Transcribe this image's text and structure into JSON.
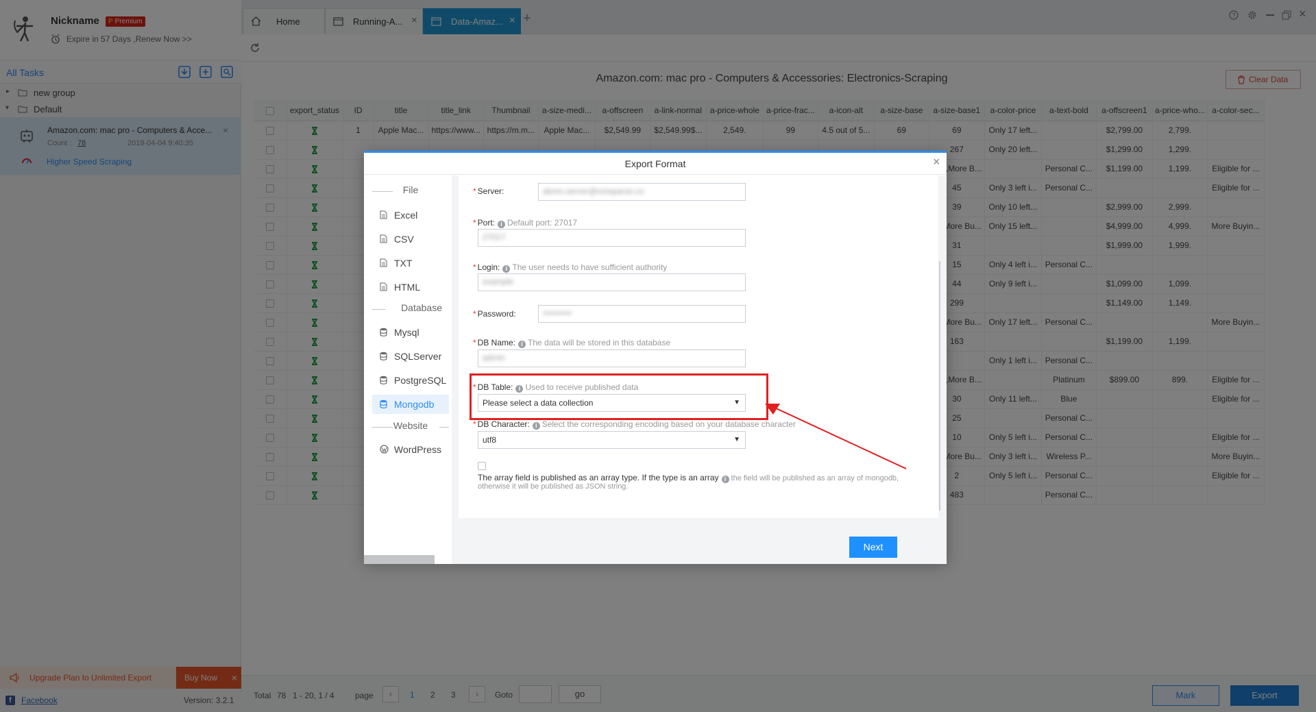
{
  "profile": {
    "nickname": "Nickname",
    "badge_p": "P",
    "badge_text": "Premium",
    "expire": "Expire in 57 Days ,Renew Now >>"
  },
  "sidebar": {
    "all_tasks": "All Tasks",
    "groups": [
      {
        "label": "new group"
      },
      {
        "label": "Default"
      }
    ],
    "task": {
      "title": "Amazon.com: mac pro - Computers & Acce...",
      "count_label": "Count :",
      "count": "78",
      "date": "2019-04-04 9:40:35",
      "speed": "Higher Speed Scraping"
    },
    "upgrade": "Upgrade Plan to Unlimited Export",
    "buy_now": "Buy Now",
    "facebook": "Facebook",
    "version": "Version: 3.2.1"
  },
  "tabs": [
    {
      "label": "Home"
    },
    {
      "label": "Running-A..."
    },
    {
      "label": "Data-Amaz..."
    }
  ],
  "main": {
    "title": "Amazon.com: mac pro - Computers & Accessories: Electronics-Scraping",
    "clear_data": "Clear Data"
  },
  "table": {
    "headers": [
      "export_status",
      "ID",
      "title",
      "title_link",
      "Thumbnail",
      "a-size-medi...",
      "a-offscreen",
      "a-link-normal",
      "a-price-whole",
      "a-price-frac...",
      "a-icon-alt",
      "a-size-base",
      "a-size-base1",
      "a-color-price",
      "a-text-bold",
      "a-offscreen1",
      "a-price-who...",
      "a-color-sec..."
    ],
    "rows": [
      [
        "1",
        "Apple Mac...",
        "https://www...",
        "https://m.m...",
        "Apple Mac...",
        "$2,549.99",
        "$2,549.99$...",
        "2,549.",
        "99",
        "4.5 out of 5...",
        "69",
        "69",
        "Only 17 left...",
        "",
        "$2,799.00",
        "2,799.",
        ""
      ],
      [
        "",
        "",
        "",
        "",
        "",
        "",
        "",
        "",
        "",
        "",
        "",
        "267",
        "Only 20 left...",
        "",
        "$1,299.00",
        "1,299.",
        ""
      ],
      [
        "",
        "",
        "",
        "",
        "",
        "",
        "",
        "",
        "",
        "",
        "",
        "321,More B...",
        "",
        "Personal C...",
        "$1,199.00",
        "1,199.",
        "Eligible for ..."
      ],
      [
        "",
        "",
        "",
        "",
        "",
        "",
        "",
        "",
        "",
        "",
        "",
        "45",
        "Only 3 left i...",
        "Personal C...",
        "",
        "",
        "Eligible for ..."
      ],
      [
        "",
        "",
        "",
        "",
        "",
        "",
        "",
        "",
        "",
        "",
        "",
        "39",
        "Only 10 left...",
        "",
        "$2,999.00",
        "2,999.",
        ""
      ],
      [
        "",
        "",
        "",
        "",
        "",
        "",
        "",
        "",
        "",
        "",
        "",
        "14,More Bu...",
        "Only 15 left...",
        "",
        "$4,999.00",
        "4,999.",
        "More Buyin..."
      ],
      [
        "",
        "",
        "",
        "",
        "",
        "",
        "",
        "",
        "",
        "",
        "",
        "31",
        "",
        "",
        "$1,999.00",
        "1,999.",
        ""
      ],
      [
        "",
        "",
        "",
        "",
        "",
        "",
        "",
        "",
        "",
        "",
        "",
        "15",
        "Only 4 left i...",
        "Personal C...",
        "",
        "",
        ""
      ],
      [
        "",
        "",
        "",
        "",
        "",
        "",
        "",
        "",
        "",
        "",
        "",
        "44",
        "Only 9 left i...",
        "",
        "$1,099.00",
        "1,099.",
        ""
      ],
      [
        "",
        "",
        "",
        "",
        "",
        "",
        "",
        "",
        "",
        "",
        "",
        "299",
        "",
        "",
        "$1,149.00",
        "1,149.",
        ""
      ],
      [
        "",
        "",
        "",
        "",
        "",
        "",
        "",
        "",
        "",
        "",
        "",
        "24,More Bu...",
        "Only 17 left...",
        "Personal C...",
        "",
        "",
        "More Buyin..."
      ],
      [
        "",
        "",
        "",
        "",
        "",
        "",
        "",
        "",
        "",
        "",
        "",
        "163",
        "",
        "",
        "$1,199.00",
        "1,199.",
        ""
      ],
      [
        "",
        "",
        "",
        "",
        "",
        "",
        "",
        "",
        "",
        "",
        "",
        "",
        "Only 1 left i...",
        "Personal C...",
        "",
        "",
        ""
      ],
      [
        "",
        "",
        "",
        "",
        "",
        "",
        "",
        "",
        "",
        "",
        "",
        "187,More B...",
        "",
        "Platinum",
        "$899.00",
        "899.",
        "Eligible for ..."
      ],
      [
        "",
        "",
        "",
        "",
        "",
        "",
        "",
        "",
        "",
        "",
        "",
        "30",
        "Only 11 left...",
        "Blue",
        "",
        "",
        "Eligible for ..."
      ],
      [
        "",
        "",
        "",
        "",
        "",
        "",
        "",
        "",
        "",
        "",
        "",
        "25",
        "",
        "Personal C...",
        "",
        "",
        ""
      ],
      [
        "",
        "",
        "",
        "",
        "",
        "",
        "",
        "",
        "",
        "",
        "",
        "10",
        "Only 5 left i...",
        "Personal C...",
        "",
        "",
        "Eligible for ..."
      ],
      [
        "",
        "",
        "",
        "",
        "",
        "",
        "",
        "",
        "",
        "",
        "",
        "22,More Bu...",
        "Only 3 left i...",
        "Wireless P...",
        "",
        "",
        "More Buyin..."
      ],
      [
        "",
        "",
        "",
        "",
        "",
        "",
        "",
        "",
        "",
        "",
        "",
        "2",
        "Only 5 left i...",
        "Personal C...",
        "",
        "",
        "Eligible for ..."
      ],
      [
        "",
        "",
        "",
        "",
        "",
        "",
        "",
        "",
        "",
        "",
        "",
        "483",
        "",
        "Personal C...",
        "",
        "",
        ""
      ]
    ]
  },
  "pagination": {
    "total_label": "Total",
    "total": "78",
    "range": "1 - 20, 1 / 4",
    "page_label": "page",
    "pages": [
      "1",
      "2",
      "3"
    ],
    "goto": "Goto",
    "go": "go"
  },
  "bottom": {
    "mark": "Mark",
    "export": "Export"
  },
  "dialog": {
    "title": "Export Format",
    "file_section": "File",
    "database_section": "Database",
    "website_section": "Website",
    "file_items": [
      {
        "label": "Excel"
      },
      {
        "label": "CSV"
      },
      {
        "label": "TXT"
      },
      {
        "label": "HTML"
      }
    ],
    "db_items": [
      {
        "label": "Mysql"
      },
      {
        "label": "SQLServer"
      },
      {
        "label": "PostgreSQL"
      },
      {
        "label": "Mongodb"
      }
    ],
    "web_items": [
      {
        "label": "WordPress"
      }
    ],
    "server": {
      "label": "Server:",
      "value": "demo.server@octoparse.co"
    },
    "port": {
      "label": "Port:",
      "hint": "Default port: 27017",
      "value": "27017"
    },
    "login": {
      "label": "Login:",
      "hint": "The user needs to have sufficient authority",
      "value": "example"
    },
    "password": {
      "label": "Password:",
      "value": "••••••••••"
    },
    "dbname": {
      "label": "DB Name:",
      "hint": "The data will be stored in this database",
      "value": "admin"
    },
    "dbtable": {
      "label": "DB Table:",
      "hint": "Used to receive published data",
      "value": "Please select a data collection"
    },
    "dbchar": {
      "label": "DB Character:",
      "hint": "Select the corresponding encoding based on your database character",
      "value": "utf8"
    },
    "array_label": "The array field is published as an array type. If the type is an array",
    "array_hint": "the field will be published as an array of mongodb,",
    "array_hint2": "otherwise it will be published as JSON string.",
    "next": "Next"
  },
  "colors": {
    "accent": "#2d8cf0",
    "highlight": "#e02020",
    "buy": "#e8572a"
  }
}
